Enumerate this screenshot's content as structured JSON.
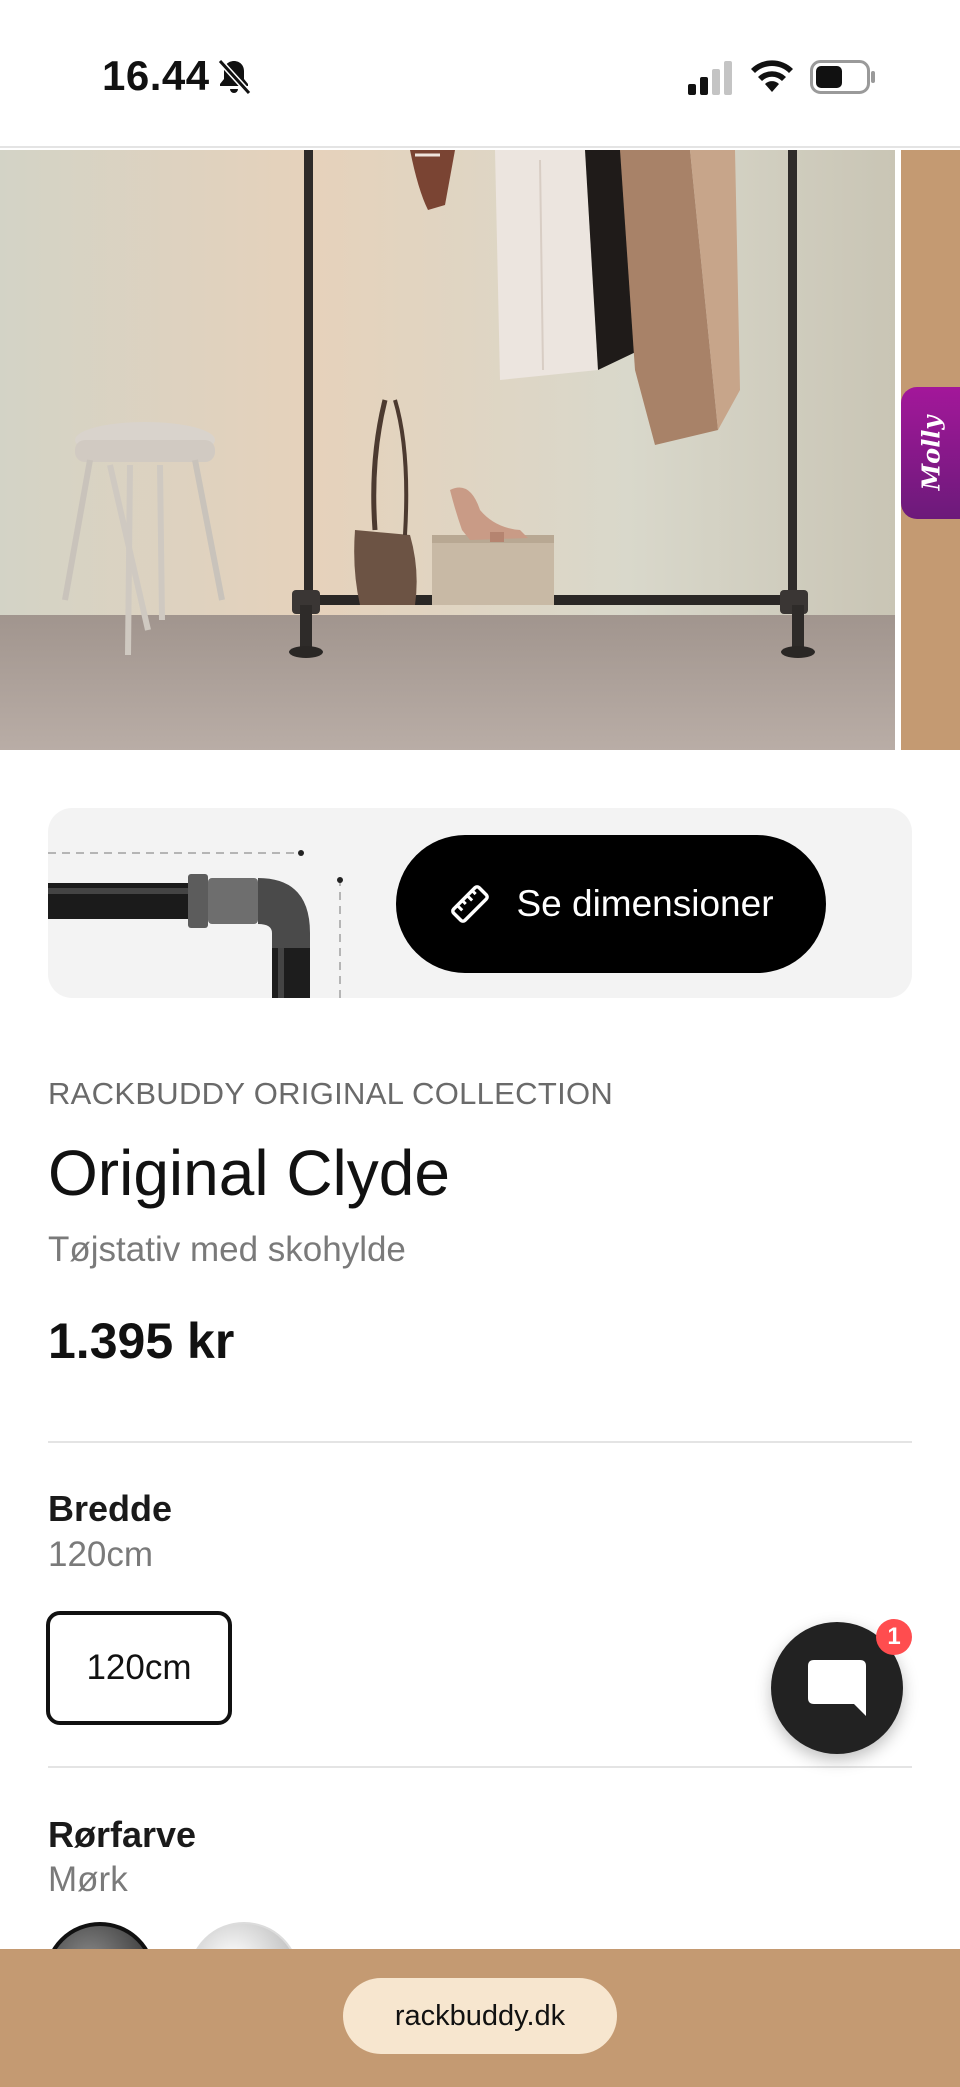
{
  "status_bar": {
    "time": "16.44",
    "icons": [
      "bell-slash-icon",
      "cellular-signal-icon",
      "wifi-icon",
      "battery-icon"
    ]
  },
  "hero": {
    "side_tab_label": "Molly"
  },
  "dimensions": {
    "button_label": "Se dimensioner",
    "icon": "ruler-icon"
  },
  "product": {
    "collection": "RACKBUDDY ORIGINAL COLLECTION",
    "title": "Original Clyde",
    "subtitle": "Tøjstativ med skohylde",
    "price": "1.395 kr"
  },
  "width_option": {
    "label": "Bredde",
    "selected_value": "120cm",
    "options": [
      "120cm"
    ]
  },
  "pipe_color_option": {
    "label": "Rørfarve",
    "selected_value": "Mørk"
  },
  "chat": {
    "icon": "chat-bubble-icon",
    "badge_count": "1"
  },
  "browser": {
    "url": "rackbuddy.dk"
  },
  "colors": {
    "accent_black": "#000000",
    "bottom_bar": "#c49a72",
    "url_pill": "#f7e6cf",
    "molly_tab": "#a3179a",
    "badge": "#ff4d4f"
  }
}
